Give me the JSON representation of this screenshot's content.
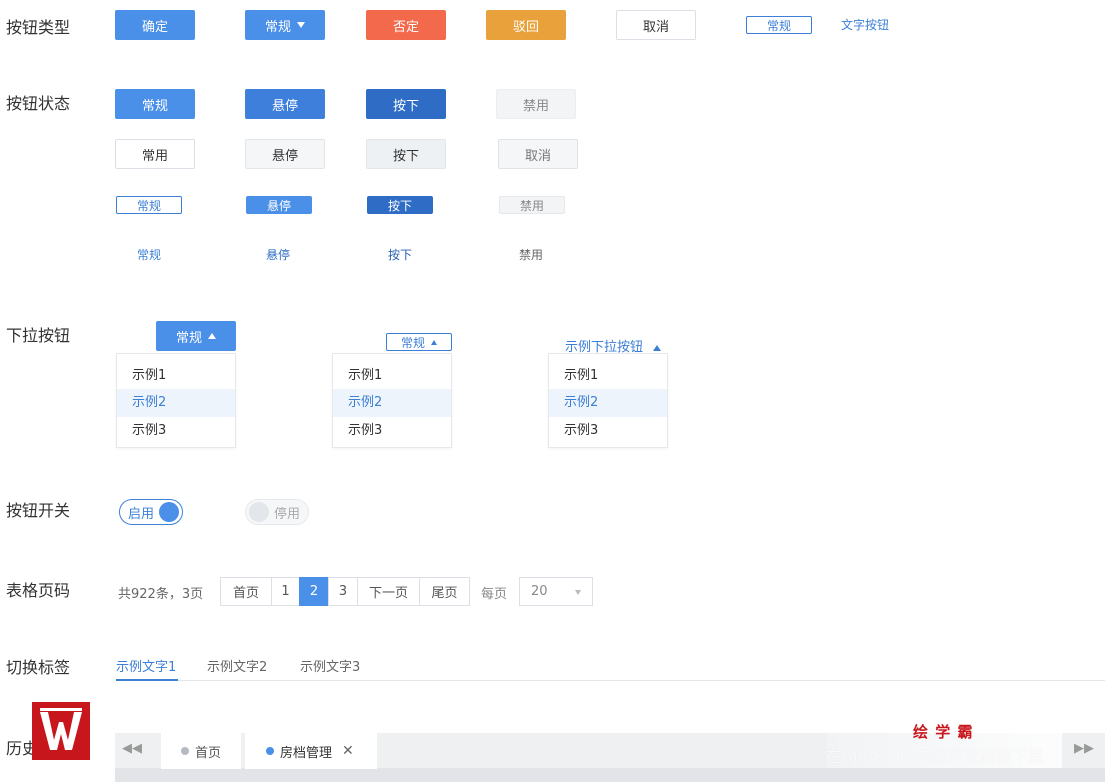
{
  "rows": {
    "types": "按钮类型",
    "states": "按钮状态",
    "dropdown": "下拉按钮",
    "switch": "按钮开关",
    "pager": "表格页码",
    "tabs": "切换标签",
    "history": "历史"
  },
  "button_types": {
    "confirm": "确定",
    "normal": "常规",
    "deny": "否定",
    "reject": "驳回",
    "cancel": "取消",
    "small_normal": "常规",
    "text_button": "文字按钮"
  },
  "button_states": {
    "row1": [
      "常规",
      "悬停",
      "按下",
      "禁用"
    ],
    "row2": [
      "常用",
      "悬停",
      "按下",
      "取消"
    ],
    "row3": [
      "常规",
      "悬停",
      "按下",
      "禁用"
    ],
    "row4": [
      "常规",
      "悬停",
      "按下",
      "禁用"
    ]
  },
  "dropdowns": {
    "d1_label": "常规",
    "d2_label": "常规",
    "d3_label": "示例下拉按钮",
    "items": [
      "示例1",
      "示例2",
      "示例3"
    ],
    "active_index": 1
  },
  "switches": {
    "on_label": "启用",
    "off_label": "停用"
  },
  "pager": {
    "summary": "共922条，3页",
    "first": "首页",
    "pages": [
      "1",
      "2",
      "3"
    ],
    "current": "2",
    "next": "下一页",
    "last": "尾页",
    "per_page_label": "每页",
    "per_page_value": "20"
  },
  "tabs": [
    "示例文字1",
    "示例文字2",
    "示例文字3"
  ],
  "history_bar": {
    "tab_home": "首页",
    "tab_active": "房档管理"
  },
  "watermark": {
    "brand": "绘 学 霸",
    "text": "在AppStore或应用宝搜索下载"
  },
  "colors": {
    "primary": "#4a8fe8",
    "danger": "#f26a4b",
    "warning": "#e9a23b",
    "link": "#3b7fd6",
    "logo": "#c8161d"
  }
}
